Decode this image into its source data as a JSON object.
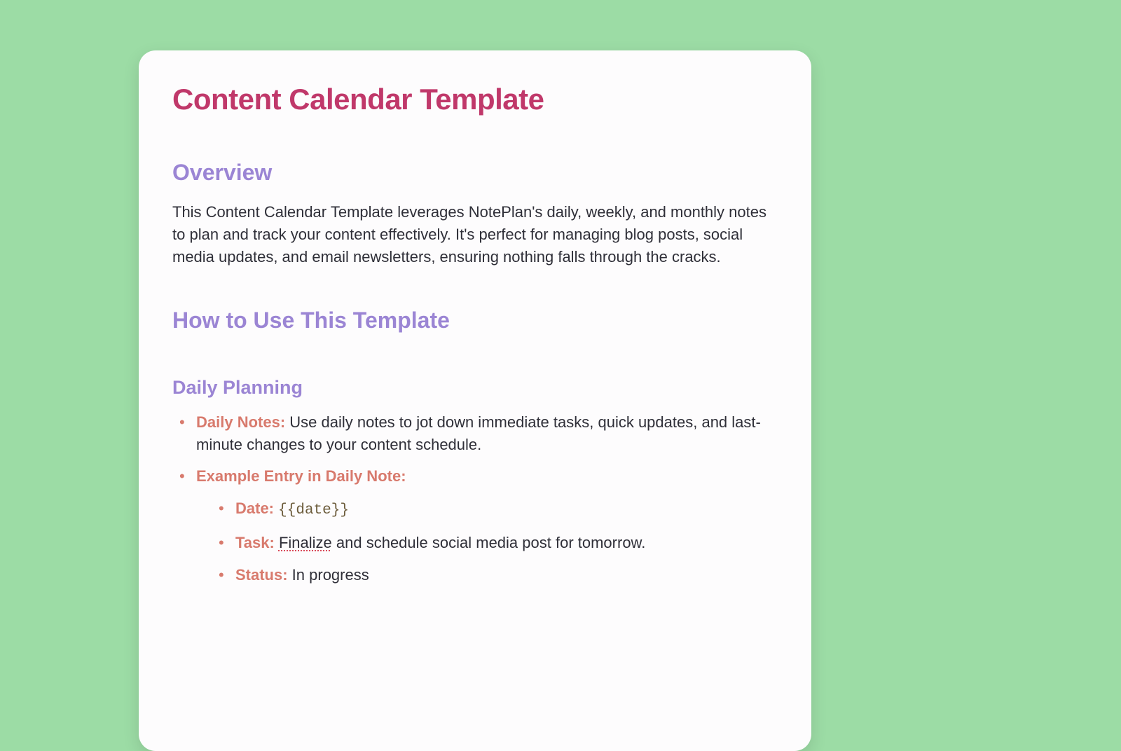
{
  "title": "Content Calendar Template",
  "overview": {
    "heading": "Overview",
    "body": "This Content Calendar Template leverages NotePlan's daily, weekly, and monthly notes to plan and track your content effectively. It's perfect for managing blog posts, social media updates, and email newsletters, ensuring nothing falls through the cracks."
  },
  "howto": {
    "heading": "How to Use This Template"
  },
  "daily": {
    "heading": "Daily Planning",
    "item1": {
      "label": "Daily Notes:",
      "text": " Use daily notes to jot down immediate tasks, quick updates, and last-minute changes to your content schedule."
    },
    "item2": {
      "label": "Example Entry in Daily Note:"
    },
    "sub": {
      "date_label": "Date:",
      "date_value": "{{date}}",
      "task_label": "Task:",
      "task_spell": "Finalize",
      "task_rest": " and schedule social media post for tomorrow.",
      "status_label": "Status:",
      "status_value": " In progress"
    }
  }
}
